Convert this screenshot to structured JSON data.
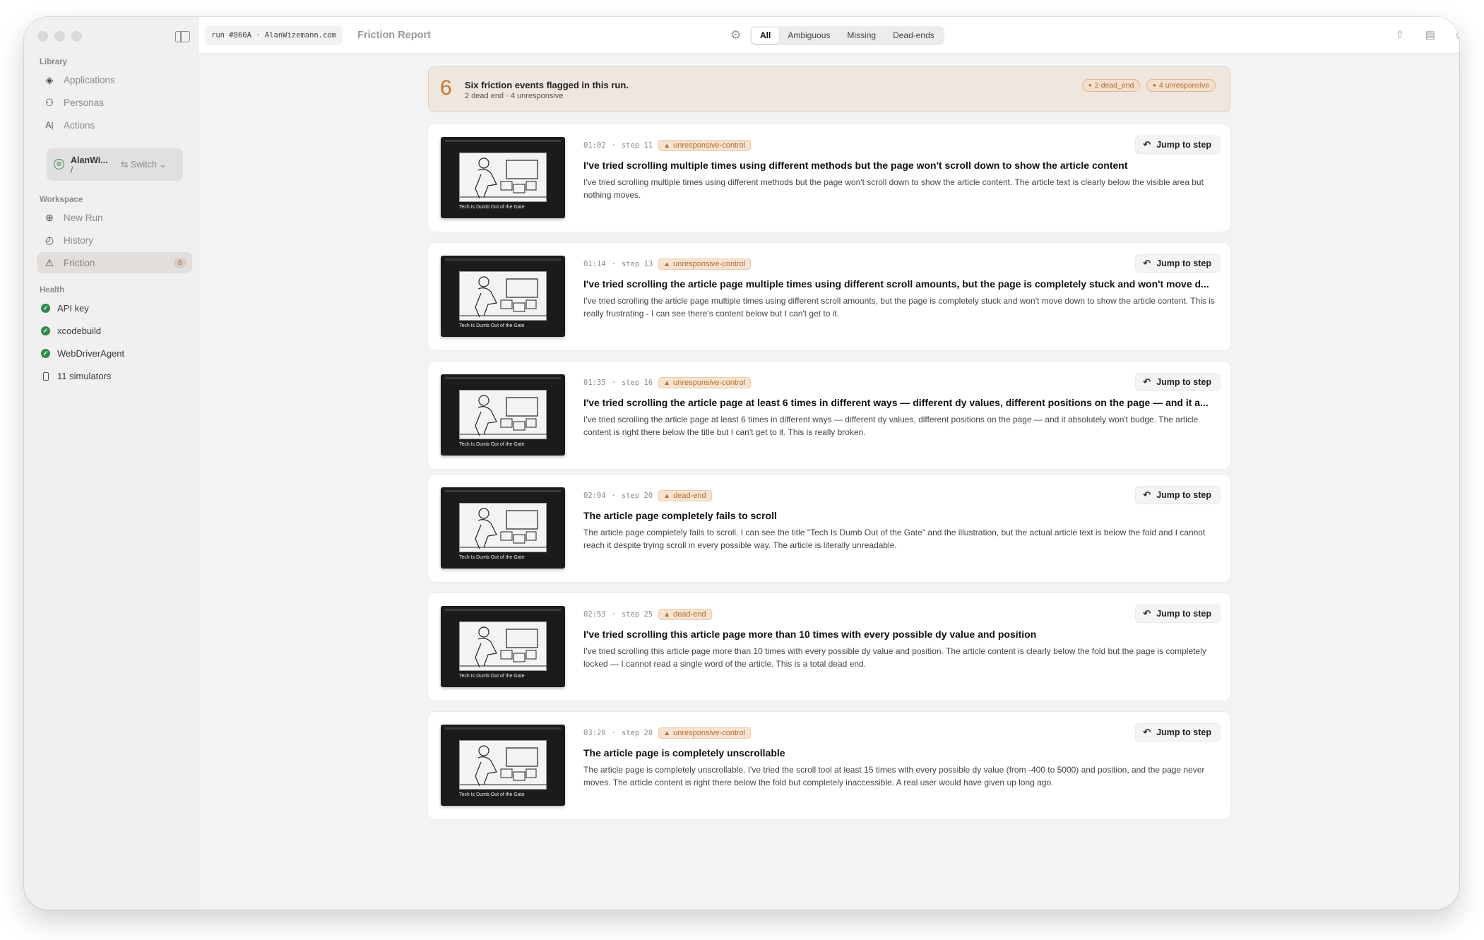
{
  "sidebar": {
    "sections": {
      "library": "Library",
      "workspace": "Workspace",
      "health": "Health"
    },
    "library_items": [
      {
        "label": "Applications",
        "icon": "layers-icon"
      },
      {
        "label": "Personas",
        "icon": "people-icon"
      },
      {
        "label": "Actions",
        "icon": "text-cursor-icon"
      }
    ],
    "switcher": {
      "name": "AlanWi...",
      "sub": "/",
      "switch_label": "Switch"
    },
    "workspace_items": [
      {
        "label": "New Run",
        "icon": "plus-circle-icon"
      },
      {
        "label": "History",
        "icon": "clock-icon"
      },
      {
        "label": "Friction",
        "icon": "warning-icon",
        "count": "6"
      }
    ],
    "health_items": [
      {
        "label": "API key",
        "status": "ok"
      },
      {
        "label": "xcodebuild",
        "status": "ok"
      },
      {
        "label": "WebDriverAgent",
        "status": "ok"
      },
      {
        "label": "11 simulators",
        "icon": "phone-icon"
      }
    ]
  },
  "topbar": {
    "run_chip": "run #860A · AlanWizemann.com",
    "title": "Friction Report",
    "filters": [
      "All",
      "Ambiguous",
      "Missing",
      "Dead-ends"
    ],
    "active_filter": "All"
  },
  "summary": {
    "count": "6",
    "headline": "Six friction events flagged in this run.",
    "sub": "2 dead end · 4 unresponsive",
    "pills": [
      "2 dead_end",
      "4 unresponsive"
    ]
  },
  "events": [
    {
      "time": "01:02",
      "step": "step 11",
      "tag": "unresponsive-control",
      "title": "I've tried scrolling multiple times using different methods but the page won't scroll down to show the article content",
      "body": "I've tried scrolling multiple times using different methods but the page won't scroll down to show the article content. The article text is clearly below the visible area but nothing moves.",
      "jump": "Jump to step",
      "caption": "Tech Is Dumb Out of the Gate"
    },
    {
      "time": "01:14",
      "step": "step 13",
      "tag": "unresponsive-control",
      "title": "I've tried scrolling the article page multiple times using different scroll amounts, but the page is completely stuck and won't move d...",
      "body": "I've tried scrolling the article page multiple times using different scroll amounts, but the page is completely stuck and won't move down to show the article content. This is really frustrating - I can see there's content below but I can't get to it.",
      "jump": "Jump to step",
      "caption": "Tech Is Dumb Out of the Gate"
    },
    {
      "time": "01:35",
      "step": "step 16",
      "tag": "unresponsive-control",
      "title": "I've tried scrolling the article page at least 6 times in different ways — different dy values, different positions on the page — and it a...",
      "body": "I've tried scrolling the article page at least 6 times in different ways — different dy values, different positions on the page — and it absolutely won't budge. The article content is right there below the title but I can't get to it. This is really broken.",
      "jump": "Jump to step",
      "caption": "Tech Is Dumb Out of the Gate"
    },
    {
      "time": "02:04",
      "step": "step 20",
      "tag": "dead-end",
      "title": "The article page completely fails to scroll",
      "body": "The article page completely fails to scroll. I can see the title \"Tech Is Dumb Out of the Gate\" and the illustration, but the actual article text is below the fold and I cannot reach it despite trying scroll in every possible way. The article is literally unreadable.",
      "jump": "Jump to step",
      "caption": "Tech Is Dumb Out of the Gate"
    },
    {
      "time": "02:53",
      "step": "step 25",
      "tag": "dead-end",
      "title": "I've tried scrolling this article page more than 10 times with every possible dy value and position",
      "body": "I've tried scrolling this article page more than 10 times with every possible dy value and position. The article content is clearly below the fold but the page is completely locked — I cannot read a single word of the article. This is a total dead end.",
      "jump": "Jump to step",
      "caption": "Tech Is Dumb Out of the Gate"
    },
    {
      "time": "03:20",
      "step": "step 28",
      "tag": "unresponsive-control",
      "title": "The article page is completely unscrollable",
      "body": "The article page is completely unscrollable. I've tried the scroll tool at least 15 times with every possible dy value (from -400 to 5000) and position, and the page never moves. The article content is right there below the fold but completely inaccessible. A real user would have given up long ago.",
      "jump": "Jump to step",
      "caption": "Tech Is Dumb Out of the Gate"
    }
  ],
  "colors": {
    "accent": "#c9752d",
    "health_ok": "#2f8b4c",
    "summary_bg": "#efe6e0"
  }
}
